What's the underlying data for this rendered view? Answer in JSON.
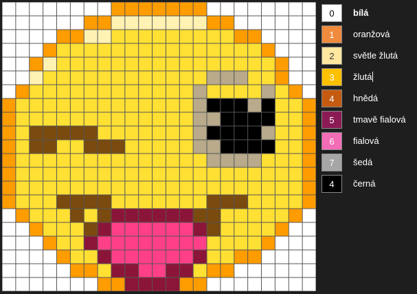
{
  "legend": [
    {
      "code": "0",
      "label": "bílá",
      "color": "#ffffff",
      "code_color": "#000000",
      "bold": true
    },
    {
      "code": "1",
      "label": "oranžová",
      "color": "#f08a3c",
      "code_color": "#ffffff"
    },
    {
      "code": "2",
      "label": "světle žlutá",
      "color": "#ffe7a0",
      "code_color": "#333333"
    },
    {
      "code": "3",
      "label": "žlutá",
      "color": "#ffc000",
      "code_color": "#ffffff",
      "caret": true
    },
    {
      "code": "4",
      "label": "hnědá",
      "color": "#c55a11",
      "code_color": "#ffffff"
    },
    {
      "code": "5",
      "label": "tmavě fialová",
      "color": "#8b1a55",
      "code_color": "#ffffff"
    },
    {
      "code": "6",
      "label": "fialová",
      "color": "#f36cb6",
      "code_color": "#ffffff"
    },
    {
      "code": "7",
      "label": "šedá",
      "color": "#a6a6a6",
      "code_color": "#ffffff"
    },
    {
      "code": "4",
      "label": "černá",
      "color": "#000000",
      "code_color": "#ffffff"
    }
  ],
  "pixel_art": {
    "palette": {
      "0": "#ffffff",
      "1": "#ff9c00",
      "2": "#fff2b3",
      "3": "#ffe033",
      "4": "#7a4a0f",
      "5": "#8b1538",
      "6": "#ff3f87",
      "7": "#b8aa8a",
      "8": "#000000"
    },
    "rows": [
      "00000000111111100000000",
      "00000011222222211000000",
      "00001122333333333110000",
      "00013333333333333331000",
      "00123333333333333333100",
      "00233333333333377733100",
      "01333333333333733337310",
      "13333333333333788878331",
      "13333333333333778888331",
      "13444443333333788887331",
      "13443344433333778888331",
      "13333333333333377773331",
      "13333333333333333333331",
      "13333333333333333333331",
      "13334444333333344433331",
      "01333434555555443333310",
      "00133345666666543333100",
      "00013356666666633331000",
      "00001335666666533110000",
      "00000113556655311000000",
      "00000001155551100000000"
    ]
  }
}
